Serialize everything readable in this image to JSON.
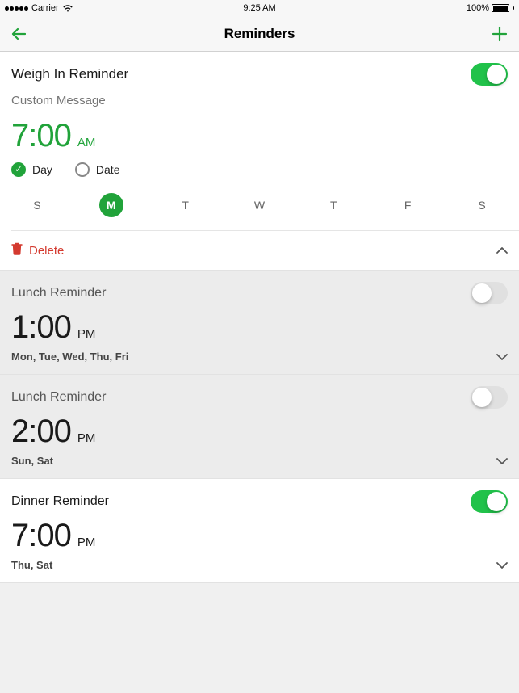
{
  "status": {
    "carrier": "Carrier",
    "time": "9:25 AM",
    "battery": "100%"
  },
  "nav": {
    "title": "Reminders"
  },
  "expanded": {
    "title": "Weigh In Reminder",
    "custom_placeholder": "Custom Message",
    "time": "7:00",
    "ampm": "AM",
    "radio_day": "Day",
    "radio_date": "Date",
    "weekdays": [
      "S",
      "M",
      "T",
      "W",
      "T",
      "F",
      "S"
    ],
    "delete_label": "Delete"
  },
  "collapsed": [
    {
      "title": "Lunch Reminder",
      "time": "1:00",
      "ampm": "PM",
      "days": "Mon, Tue, Wed, Thu, Fri",
      "enabled": false
    },
    {
      "title": "Lunch Reminder",
      "time": "2:00",
      "ampm": "PM",
      "days": "Sun, Sat",
      "enabled": false
    },
    {
      "title": "Dinner Reminder",
      "time": "7:00",
      "ampm": "PM",
      "days": "Thu, Sat",
      "enabled": true
    }
  ]
}
